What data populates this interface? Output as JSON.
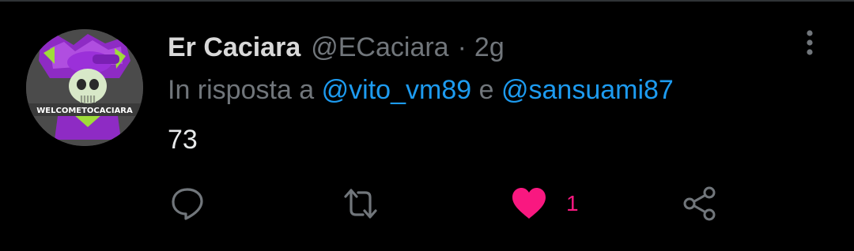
{
  "tweet": {
    "author_name": "Er Caciara",
    "handle": "@ECaciara",
    "separator": "·",
    "time": "2g",
    "reply_prefix": "In risposta a",
    "reply_mentions": [
      "@vito_vm89",
      "@sansuami87"
    ],
    "reply_conjunction": "e",
    "text": "73"
  },
  "avatar": {
    "banner_text": "WELCOMETOCACIARA"
  },
  "actions": {
    "reply": {
      "icon": "reply-icon",
      "count": ""
    },
    "retweet": {
      "icon": "retweet-icon",
      "count": ""
    },
    "like": {
      "icon": "heart-icon",
      "count": "1",
      "liked": true
    },
    "share": {
      "icon": "share-icon"
    }
  },
  "colors": {
    "background": "#000000",
    "secondary_text": "#71767b",
    "mention": "#1d9bf0",
    "like": "#f91880",
    "name": "#d9d9d9"
  }
}
